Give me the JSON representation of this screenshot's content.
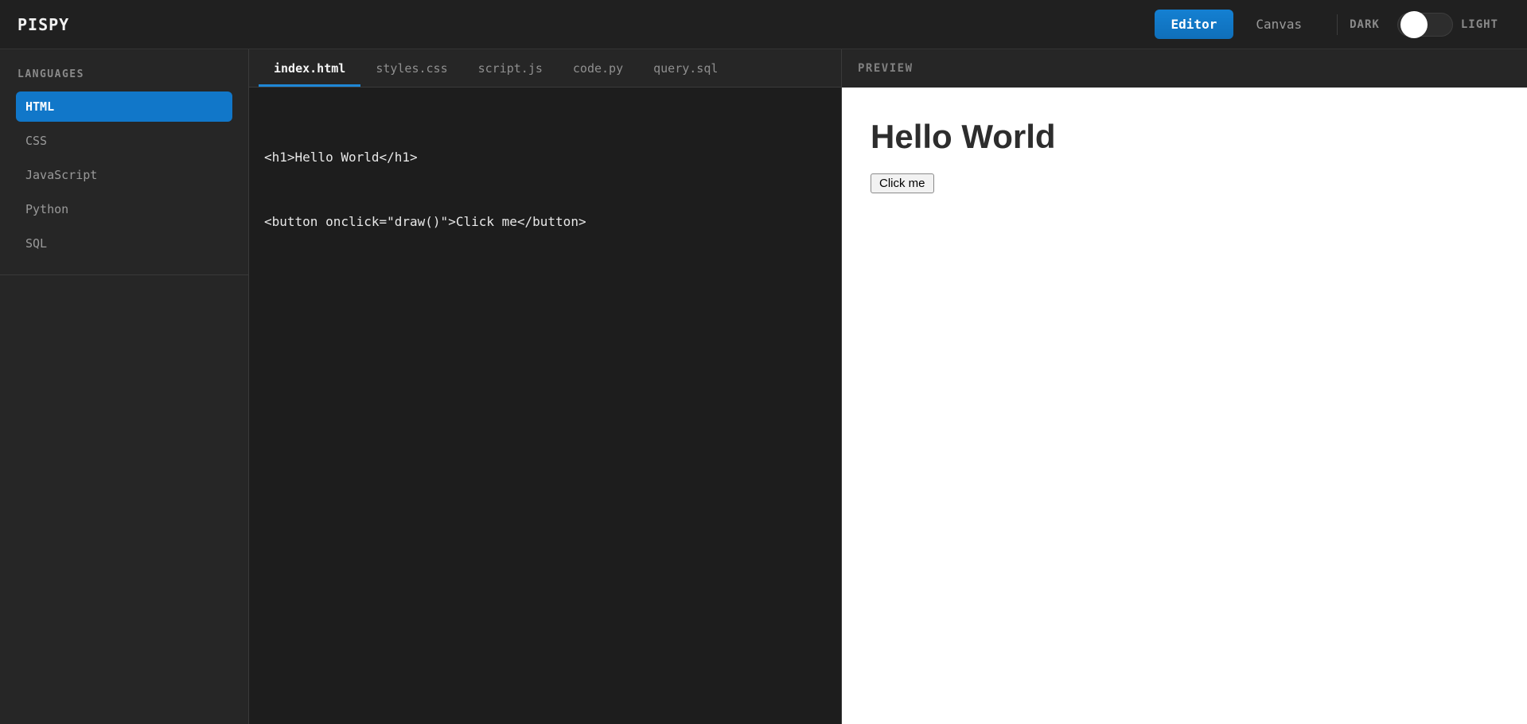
{
  "app": {
    "title": "PISPY"
  },
  "topbar": {
    "editor_button": "Editor",
    "canvas_button": "Canvas",
    "active_view": "Editor",
    "theme": {
      "dark_label": "DARK",
      "light_label": "LIGHT",
      "mode": "dark"
    }
  },
  "sidebar": {
    "heading": "LANGUAGES",
    "items": [
      {
        "label": "HTML",
        "active": true
      },
      {
        "label": "CSS",
        "active": false
      },
      {
        "label": "JavaScript",
        "active": false
      },
      {
        "label": "Python",
        "active": false
      },
      {
        "label": "SQL",
        "active": false
      }
    ]
  },
  "editor": {
    "tabs": [
      {
        "label": "index.html",
        "active": true
      },
      {
        "label": "styles.css",
        "active": false
      },
      {
        "label": "script.js",
        "active": false
      },
      {
        "label": "code.py",
        "active": false
      },
      {
        "label": "query.sql",
        "active": false
      }
    ],
    "code_lines": [
      "<h1>Hello World</h1>",
      "<button onclick=\"draw()\">Click me</button>"
    ]
  },
  "preview": {
    "heading": "PREVIEW",
    "content": {
      "title": "Hello World",
      "button_label": "Click me"
    }
  },
  "colors": {
    "accent_blue": "#1177c9",
    "tab_underline_blue": "#1e87d6",
    "topbar_bg": "#202020",
    "sidebar_bg": "#262626",
    "editor_bg": "#1d1d1d",
    "preview_bg": "#ffffff",
    "muted_text": "#8a8a8a"
  }
}
